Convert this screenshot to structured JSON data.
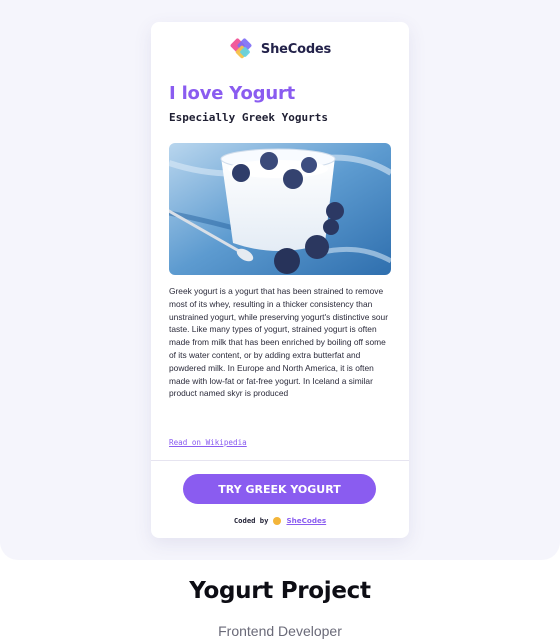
{
  "logo": {
    "text": "SheCodes",
    "icon": "shecodes-logo-icon"
  },
  "card": {
    "title": "I love Yogurt",
    "subtitle": "Especially Greek Yogurts",
    "image": "yogurt-blueberries-photo",
    "description": "Greek yogurt is a yogurt that has been strained to remove most of its whey, resulting in a thicker consistency than unstrained yogurt, while preserving yogurt's distinctive sour taste. Like many types of yogurt, strained yogurt is often made from milk that has been enriched by boiling off some of its water content, or by adding extra butterfat and powdered milk. In Europe and North America, it is often made with low-fat or fat-free yogurt. In Iceland a similar product named skyr is produced",
    "wiki_link": "Read on Wikipedia",
    "cta_label": "TRY GREEK YOGURT",
    "coded_by": "Coded by",
    "coded_link": "SheCodes"
  },
  "project": {
    "title": "Yogurt Project",
    "subtitle": "Frontend Developer"
  },
  "colors": {
    "accent": "#8a5cf0",
    "background": "#f5f5fc",
    "text": "#1f1f33"
  }
}
